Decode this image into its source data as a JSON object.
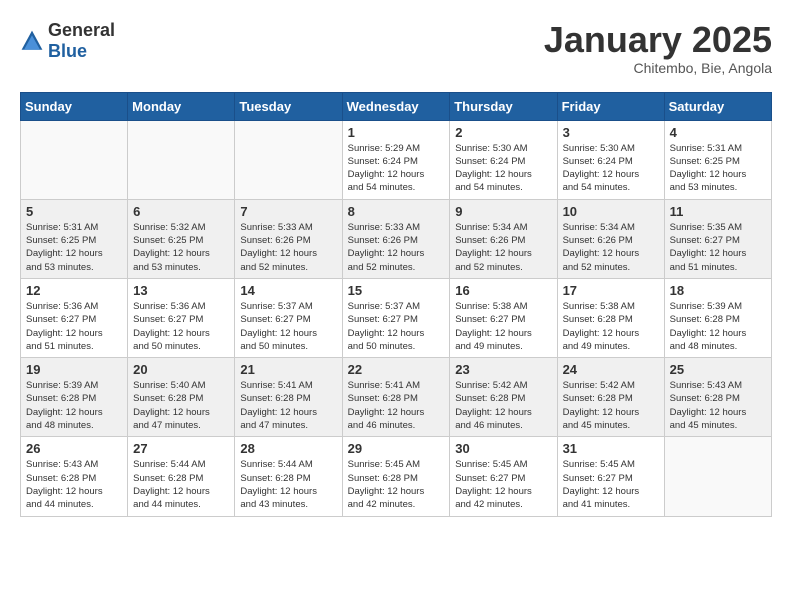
{
  "header": {
    "logo_general": "General",
    "logo_blue": "Blue",
    "month_title": "January 2025",
    "subtitle": "Chitembo, Bie, Angola"
  },
  "days_of_week": [
    "Sunday",
    "Monday",
    "Tuesday",
    "Wednesday",
    "Thursday",
    "Friday",
    "Saturday"
  ],
  "weeks": [
    {
      "days": [
        {
          "num": "",
          "info": ""
        },
        {
          "num": "",
          "info": ""
        },
        {
          "num": "",
          "info": ""
        },
        {
          "num": "1",
          "info": "Sunrise: 5:29 AM\nSunset: 6:24 PM\nDaylight: 12 hours\nand 54 minutes."
        },
        {
          "num": "2",
          "info": "Sunrise: 5:30 AM\nSunset: 6:24 PM\nDaylight: 12 hours\nand 54 minutes."
        },
        {
          "num": "3",
          "info": "Sunrise: 5:30 AM\nSunset: 6:24 PM\nDaylight: 12 hours\nand 54 minutes."
        },
        {
          "num": "4",
          "info": "Sunrise: 5:31 AM\nSunset: 6:25 PM\nDaylight: 12 hours\nand 53 minutes."
        }
      ]
    },
    {
      "days": [
        {
          "num": "5",
          "info": "Sunrise: 5:31 AM\nSunset: 6:25 PM\nDaylight: 12 hours\nand 53 minutes."
        },
        {
          "num": "6",
          "info": "Sunrise: 5:32 AM\nSunset: 6:25 PM\nDaylight: 12 hours\nand 53 minutes."
        },
        {
          "num": "7",
          "info": "Sunrise: 5:33 AM\nSunset: 6:26 PM\nDaylight: 12 hours\nand 52 minutes."
        },
        {
          "num": "8",
          "info": "Sunrise: 5:33 AM\nSunset: 6:26 PM\nDaylight: 12 hours\nand 52 minutes."
        },
        {
          "num": "9",
          "info": "Sunrise: 5:34 AM\nSunset: 6:26 PM\nDaylight: 12 hours\nand 52 minutes."
        },
        {
          "num": "10",
          "info": "Sunrise: 5:34 AM\nSunset: 6:26 PM\nDaylight: 12 hours\nand 52 minutes."
        },
        {
          "num": "11",
          "info": "Sunrise: 5:35 AM\nSunset: 6:27 PM\nDaylight: 12 hours\nand 51 minutes."
        }
      ]
    },
    {
      "days": [
        {
          "num": "12",
          "info": "Sunrise: 5:36 AM\nSunset: 6:27 PM\nDaylight: 12 hours\nand 51 minutes."
        },
        {
          "num": "13",
          "info": "Sunrise: 5:36 AM\nSunset: 6:27 PM\nDaylight: 12 hours\nand 50 minutes."
        },
        {
          "num": "14",
          "info": "Sunrise: 5:37 AM\nSunset: 6:27 PM\nDaylight: 12 hours\nand 50 minutes."
        },
        {
          "num": "15",
          "info": "Sunrise: 5:37 AM\nSunset: 6:27 PM\nDaylight: 12 hours\nand 50 minutes."
        },
        {
          "num": "16",
          "info": "Sunrise: 5:38 AM\nSunset: 6:27 PM\nDaylight: 12 hours\nand 49 minutes."
        },
        {
          "num": "17",
          "info": "Sunrise: 5:38 AM\nSunset: 6:28 PM\nDaylight: 12 hours\nand 49 minutes."
        },
        {
          "num": "18",
          "info": "Sunrise: 5:39 AM\nSunset: 6:28 PM\nDaylight: 12 hours\nand 48 minutes."
        }
      ]
    },
    {
      "days": [
        {
          "num": "19",
          "info": "Sunrise: 5:39 AM\nSunset: 6:28 PM\nDaylight: 12 hours\nand 48 minutes."
        },
        {
          "num": "20",
          "info": "Sunrise: 5:40 AM\nSunset: 6:28 PM\nDaylight: 12 hours\nand 47 minutes."
        },
        {
          "num": "21",
          "info": "Sunrise: 5:41 AM\nSunset: 6:28 PM\nDaylight: 12 hours\nand 47 minutes."
        },
        {
          "num": "22",
          "info": "Sunrise: 5:41 AM\nSunset: 6:28 PM\nDaylight: 12 hours\nand 46 minutes."
        },
        {
          "num": "23",
          "info": "Sunrise: 5:42 AM\nSunset: 6:28 PM\nDaylight: 12 hours\nand 46 minutes."
        },
        {
          "num": "24",
          "info": "Sunrise: 5:42 AM\nSunset: 6:28 PM\nDaylight: 12 hours\nand 45 minutes."
        },
        {
          "num": "25",
          "info": "Sunrise: 5:43 AM\nSunset: 6:28 PM\nDaylight: 12 hours\nand 45 minutes."
        }
      ]
    },
    {
      "days": [
        {
          "num": "26",
          "info": "Sunrise: 5:43 AM\nSunset: 6:28 PM\nDaylight: 12 hours\nand 44 minutes."
        },
        {
          "num": "27",
          "info": "Sunrise: 5:44 AM\nSunset: 6:28 PM\nDaylight: 12 hours\nand 44 minutes."
        },
        {
          "num": "28",
          "info": "Sunrise: 5:44 AM\nSunset: 6:28 PM\nDaylight: 12 hours\nand 43 minutes."
        },
        {
          "num": "29",
          "info": "Sunrise: 5:45 AM\nSunset: 6:28 PM\nDaylight: 12 hours\nand 42 minutes."
        },
        {
          "num": "30",
          "info": "Sunrise: 5:45 AM\nSunset: 6:27 PM\nDaylight: 12 hours\nand 42 minutes."
        },
        {
          "num": "31",
          "info": "Sunrise: 5:45 AM\nSunset: 6:27 PM\nDaylight: 12 hours\nand 41 minutes."
        },
        {
          "num": "",
          "info": ""
        }
      ]
    }
  ]
}
